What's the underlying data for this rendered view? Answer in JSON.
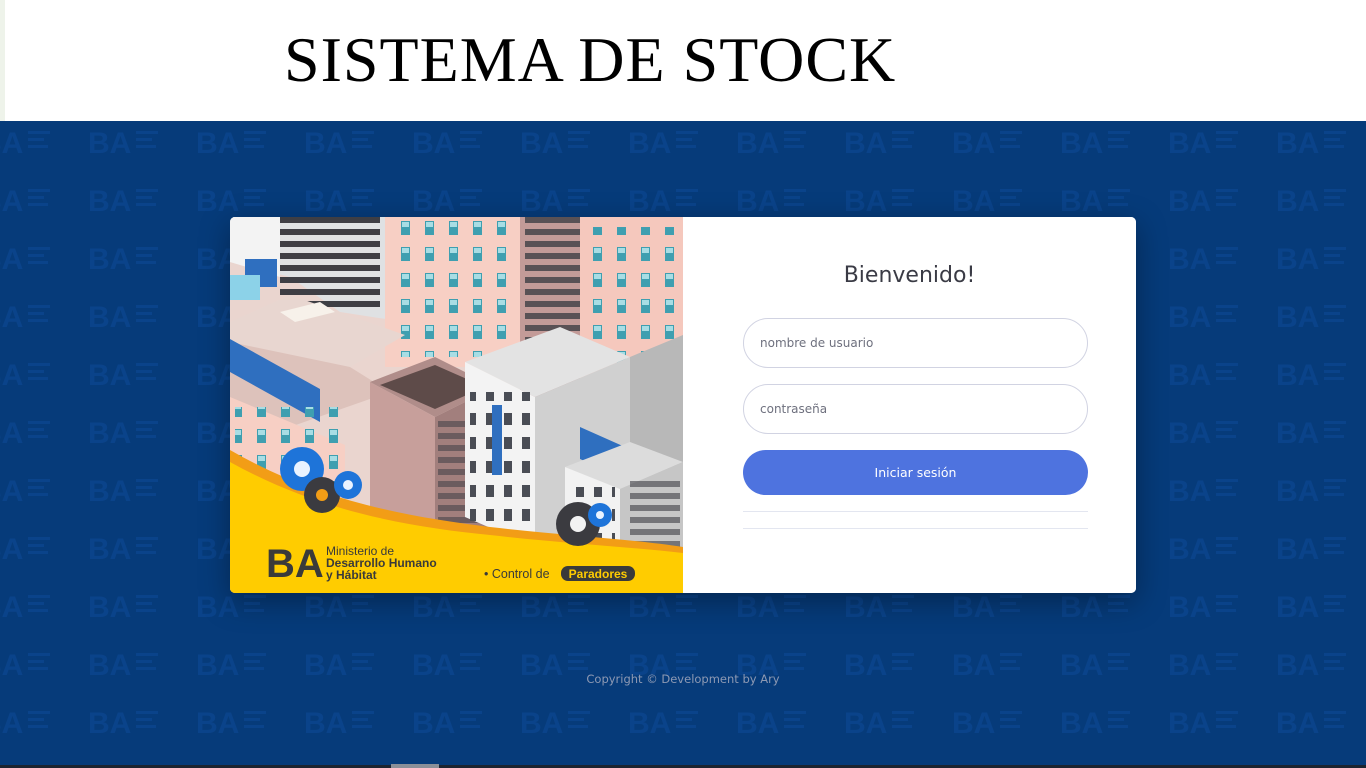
{
  "header": {
    "title": "SISTEMA DE STOCK"
  },
  "background": {
    "logo_text": "BA"
  },
  "illustration": {
    "ministry_line1": "Ministerio de",
    "ministry_line2": "Desarrollo Humano",
    "ministry_line3": "y Hábitat",
    "logo_text": "BA",
    "control_prefix": "• Control de",
    "control_badge": "Paradores"
  },
  "login": {
    "welcome": "Bienvenido!",
    "username_placeholder": "nombre de usuario",
    "password_placeholder": "contraseña",
    "submit_label": "Iniciar sesión"
  },
  "footer": {
    "copyright": "Copyright © Development by Ary"
  },
  "colors": {
    "primary": "#4e73df",
    "background": "#063b7a",
    "banner_yellow": "#ffcc00"
  }
}
